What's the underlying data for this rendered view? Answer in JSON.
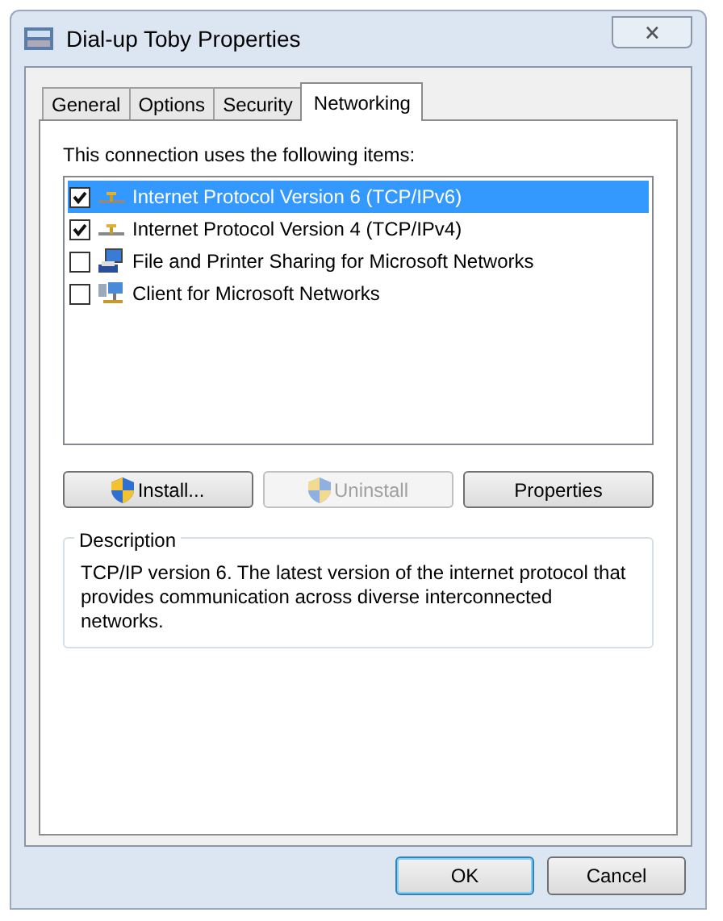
{
  "window": {
    "title": "Dial-up Toby Properties",
    "close": "🗙"
  },
  "tabs": [
    {
      "label": "General",
      "selected": false
    },
    {
      "label": "Options",
      "selected": false
    },
    {
      "label": "Security",
      "selected": false
    },
    {
      "label": "Networking",
      "selected": true
    }
  ],
  "items_label": "This connection uses the following items:",
  "items": [
    {
      "label": "Internet Protocol Version 6 (TCP/IPv6)",
      "checked": true,
      "selected": true,
      "kind": "protocol"
    },
    {
      "label": "Internet Protocol Version 4 (TCP/IPv4)",
      "checked": true,
      "selected": false,
      "kind": "protocol"
    },
    {
      "label": "File and Printer Sharing for Microsoft Networks",
      "checked": false,
      "selected": false,
      "kind": "printer"
    },
    {
      "label": "Client for Microsoft Networks",
      "checked": false,
      "selected": false,
      "kind": "client"
    }
  ],
  "item_buttons": [
    {
      "label": "Install...",
      "kind": "shield",
      "disabled": false
    },
    {
      "label": "Uninstall",
      "kind": "shield",
      "disabled": true
    },
    {
      "label": "Properties",
      "kind": "plain",
      "disabled": false
    }
  ],
  "description": {
    "title": "Description",
    "text": "TCP/IP version 6. The latest version of the internet protocol that provides communication across diverse interconnected networks."
  },
  "buttons": [
    {
      "label": "OK",
      "default": true
    },
    {
      "label": "Cancel",
      "default": false
    }
  ]
}
